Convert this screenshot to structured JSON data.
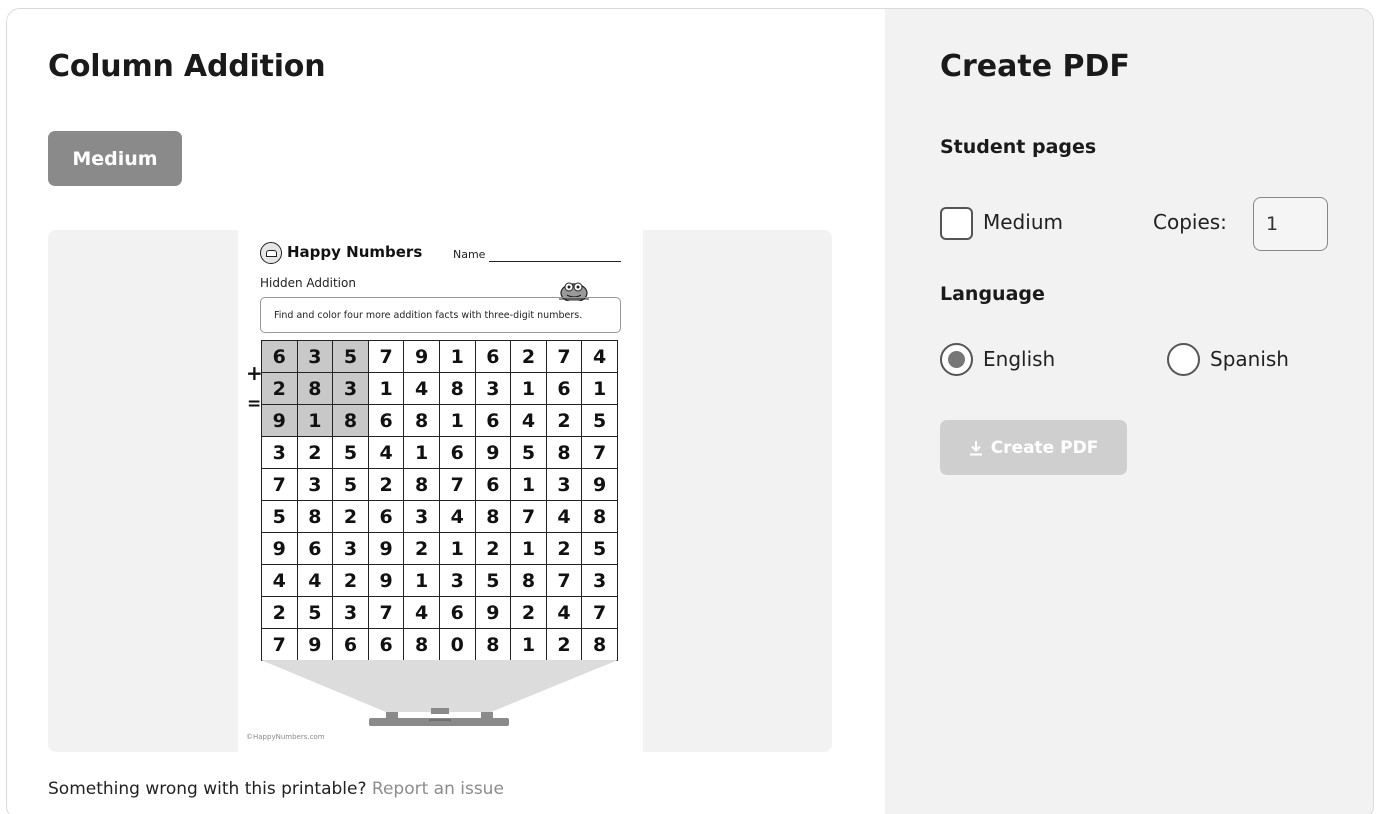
{
  "page": {
    "title": "Column Addition",
    "level_button": "Medium",
    "report_text": "Something wrong with this printable?",
    "report_link": "Report an issue"
  },
  "worksheet": {
    "brand": "Happy Numbers",
    "name_label": "Name",
    "subtitle": "Hidden Addition",
    "instructions": "Find and color four more addition facts with three-digit numbers.",
    "plus_sign": "+",
    "equals_sign": "=",
    "footer": "©HappyNumbers.com",
    "grid": [
      [
        "6",
        "3",
        "5",
        "7",
        "9",
        "1",
        "6",
        "2",
        "7",
        "4"
      ],
      [
        "2",
        "8",
        "3",
        "1",
        "4",
        "8",
        "3",
        "1",
        "6",
        "1"
      ],
      [
        "9",
        "1",
        "8",
        "6",
        "8",
        "1",
        "6",
        "4",
        "2",
        "5"
      ],
      [
        "3",
        "2",
        "5",
        "4",
        "1",
        "6",
        "9",
        "5",
        "8",
        "7"
      ],
      [
        "7",
        "3",
        "5",
        "2",
        "8",
        "7",
        "6",
        "1",
        "3",
        "9"
      ],
      [
        "5",
        "8",
        "2",
        "6",
        "3",
        "4",
        "8",
        "7",
        "4",
        "8"
      ],
      [
        "9",
        "6",
        "3",
        "9",
        "2",
        "1",
        "2",
        "1",
        "2",
        "5"
      ],
      [
        "4",
        "4",
        "2",
        "9",
        "1",
        "3",
        "5",
        "8",
        "7",
        "3"
      ],
      [
        "2",
        "5",
        "3",
        "7",
        "4",
        "6",
        "9",
        "2",
        "4",
        "7"
      ],
      [
        "7",
        "9",
        "6",
        "6",
        "8",
        "0",
        "8",
        "1",
        "2",
        "8"
      ]
    ]
  },
  "pdf_panel": {
    "title": "Create PDF",
    "student_pages_label": "Student pages",
    "checkbox_label": "Medium",
    "copies_label": "Copies:",
    "copies_value": "1",
    "language_label": "Language",
    "lang_english": "English",
    "lang_spanish": "Spanish",
    "create_button": "Create PDF"
  }
}
